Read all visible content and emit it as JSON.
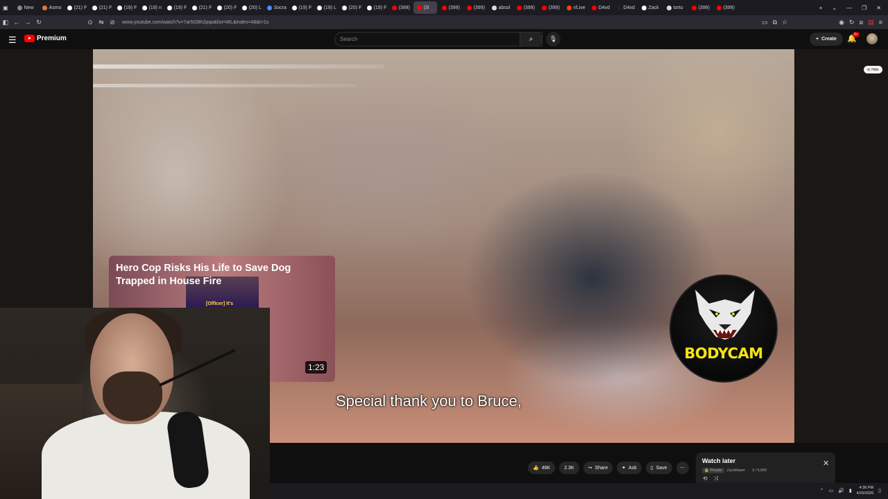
{
  "browser": {
    "tabs": [
      {
        "label": "New",
        "color": "#888888"
      },
      {
        "label": "Asmo",
        "color": "#e0783a"
      },
      {
        "label": "(21) F",
        "color": "#ffffff"
      },
      {
        "label": "(21) F",
        "color": "#ffffff"
      },
      {
        "label": "(19) F",
        "color": "#ffffff"
      },
      {
        "label": "(19) n",
        "color": "#ffffff"
      },
      {
        "label": "(19) F",
        "color": "#ffffff"
      },
      {
        "label": "(21) F",
        "color": "#ffffff"
      },
      {
        "label": "(20) F",
        "color": "#ffffff"
      },
      {
        "label": "(20) L",
        "color": "#ffffff"
      },
      {
        "label": "Socra",
        "color": "#4a8cff"
      },
      {
        "label": "(19) F",
        "color": "#ffffff"
      },
      {
        "label": "(19) L",
        "color": "#ffffff"
      },
      {
        "label": "(20) F",
        "color": "#ffffff"
      },
      {
        "label": "(19) F",
        "color": "#ffffff"
      },
      {
        "label": "(399)",
        "color": "#ff0000"
      },
      {
        "label": "(3!",
        "color": "#ff0000",
        "active": true
      },
      {
        "label": "(399)",
        "color": "#ff0000"
      },
      {
        "label": "(399)",
        "color": "#ff0000"
      },
      {
        "label": "absol",
        "color": "#dddddd"
      },
      {
        "label": "(399)",
        "color": "#ff0000"
      },
      {
        "label": "(399)",
        "color": "#ff0000"
      },
      {
        "label": "r/Live",
        "color": "#ff4500"
      },
      {
        "label": "D4vd",
        "color": "#ff0000"
      },
      {
        "label": "D4vd",
        "color": "#222222"
      },
      {
        "label": "Zack",
        "color": "#ffffff"
      },
      {
        "label": "tortu",
        "color": "#dddddd"
      },
      {
        "label": "(399)",
        "color": "#ff0000"
      },
      {
        "label": "(399)",
        "color": "#ff0000"
      }
    ],
    "url": "www.youtube.com/watch?v=7ar5GBh2pqo&list=WL&index=48&t=1s"
  },
  "youtube": {
    "logo_text": "Premium",
    "search_placeholder": "Search",
    "create_label": "Create",
    "notif_count": "9+"
  },
  "player": {
    "hide_label": "Hide",
    "subtitle": "Special thank you to Bruce,",
    "card": {
      "title": "Hero Cop Risks His Life to Save Dog Trapped in House Fire",
      "thumb_caption": "[Officer] It's",
      "duration": "1:23"
    },
    "channel_logo_text": "BODYCAM"
  },
  "actions": {
    "like_count": "48K",
    "dislike_count": "2.3K",
    "share_label": "Share",
    "ask_label": "Ask",
    "save_label": "Save"
  },
  "watch_later": {
    "title": "Watch later",
    "privacy": "Private",
    "owner": "ZackRawrr",
    "progress": "3 / 5,000"
  },
  "taskbar": {
    "time": "4:36 PM",
    "date": "4/25/2026"
  }
}
